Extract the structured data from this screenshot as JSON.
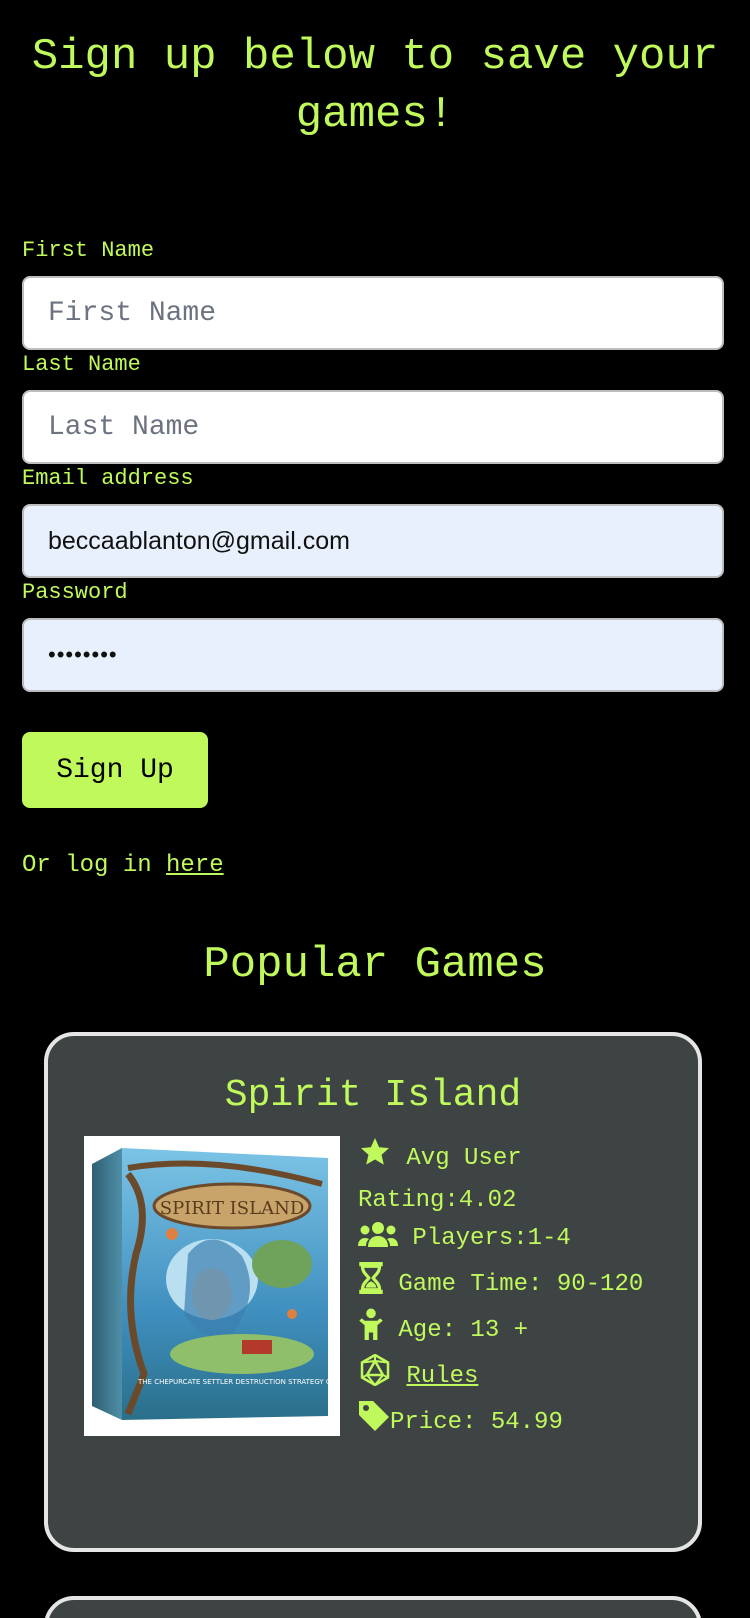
{
  "signup": {
    "title": "Sign up below to save your games!",
    "fields": {
      "first_name": {
        "label": "First Name",
        "placeholder": "First Name",
        "value": ""
      },
      "last_name": {
        "label": "Last Name",
        "placeholder": "Last Name",
        "value": ""
      },
      "email": {
        "label": "Email address",
        "placeholder": "",
        "value": "beccaablanton@gmail.com"
      },
      "password": {
        "label": "Password",
        "placeholder": "",
        "value": "••••••••"
      }
    },
    "button_label": "Sign Up",
    "login_prefix": "Or log in ",
    "login_link": "here"
  },
  "popular": {
    "title": "Popular Games",
    "games": [
      {
        "name": "Spirit Island",
        "rating_label": "Avg User Rating:",
        "rating": "4.02",
        "players_label": "Players:",
        "players": "1-4",
        "time_label": "Game Time: ",
        "time": "90-120",
        "age_label": "Age: ",
        "age": "13 +",
        "rules_label": "Rules",
        "price_label": "Price: ",
        "price": "54.99",
        "image_text": "SPIRIT ISLAND",
        "image_subtext": "THE CHEPURCATE SETTLER DESTRUCTION STRATEGY GAME"
      }
    ]
  },
  "colors": {
    "accent": "#c0f95b",
    "background": "#000000",
    "card": "#3e4444",
    "card_border": "#e5e5e5",
    "autofill": "#e8f0fe"
  },
  "icons": {
    "rating": "star-icon",
    "players": "users-icon",
    "time": "hourglass-icon",
    "age": "child-icon",
    "rules": "dice-icon",
    "price": "tag-icon"
  }
}
